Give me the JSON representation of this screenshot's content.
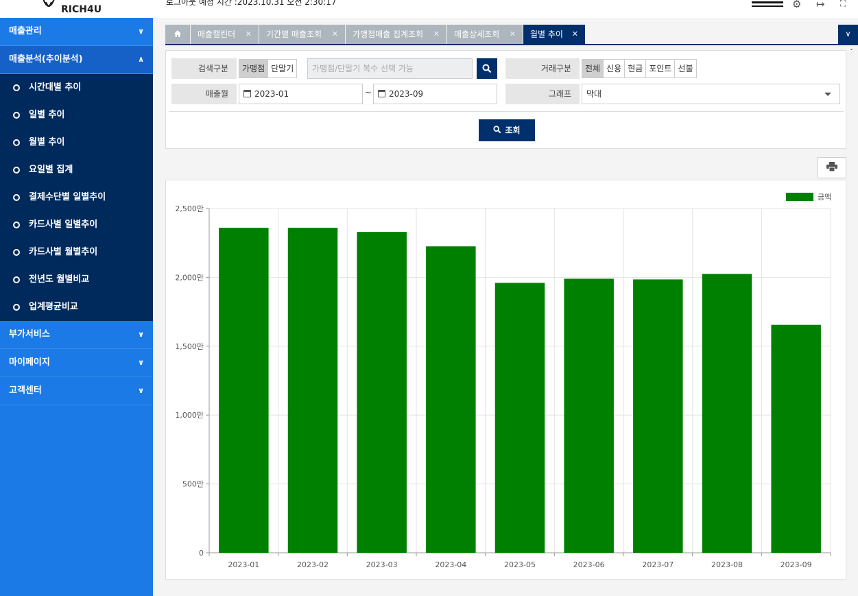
{
  "brand": {
    "name": "RICH4U"
  },
  "topbar": {
    "logout_text": "로그아웃 예정 시간 :2023.10.31 오전 2:30:17"
  },
  "sidebar": {
    "menus": [
      {
        "label": "매출관리",
        "open": false
      },
      {
        "label": "매출분석(추이분석)",
        "open": true
      },
      {
        "label": "부가서비스",
        "open": false
      },
      {
        "label": "마이페이지",
        "open": false
      },
      {
        "label": "고객센터",
        "open": false
      }
    ],
    "sub_items": [
      "시간대별 추이",
      "일별 추이",
      "월별 추이",
      "요일별 집계",
      "결제수단별 일별추이",
      "카드사별 일별추이",
      "카드사별 월별추이",
      "전년도 월별비교",
      "업계평균비교"
    ]
  },
  "tabs": [
    {
      "label": "매출캘린더",
      "active": false
    },
    {
      "label": "기간별 매출조회",
      "active": false
    },
    {
      "label": "가맹점매출 집계조회",
      "active": false
    },
    {
      "label": "매출상세조회",
      "active": false
    },
    {
      "label": "월별 추이",
      "active": true
    }
  ],
  "filter": {
    "search_type_label": "검색구분",
    "search_type_options": [
      "가맹점",
      "단말기"
    ],
    "search_type_selected": "가맹점",
    "search_placeholder": "가맹점/단말기 복수 선택 가능",
    "month_label": "매출월",
    "month_from": "2023-01",
    "month_tilde": "~",
    "month_to": "2023-09",
    "trade_type_label": "거래구분",
    "trade_type_options": [
      "전체",
      "신용",
      "현금",
      "포인트",
      "선불"
    ],
    "trade_type_selected": "전체",
    "graph_label": "그래프",
    "graph_value": "막대",
    "submit_label": "조회"
  },
  "chart_data": {
    "type": "bar",
    "categories": [
      "2023-01",
      "2023-02",
      "2023-03",
      "2023-04",
      "2023-05",
      "2023-06",
      "2023-07",
      "2023-08",
      "2023-09"
    ],
    "series": [
      {
        "name": "금액",
        "values": [
          2360,
          2360,
          2330,
          2225,
          1960,
          1990,
          1985,
          2025,
          1655
        ],
        "color": "#008000"
      }
    ],
    "ylim": [
      0,
      2500
    ],
    "yticks": [
      0,
      500,
      1000,
      1500,
      2000,
      2500
    ],
    "ytick_labels": [
      "0",
      "500만",
      "1,000만",
      "1,500만",
      "2,000만",
      "2,500만"
    ],
    "grid": true,
    "legend": "top-right"
  }
}
